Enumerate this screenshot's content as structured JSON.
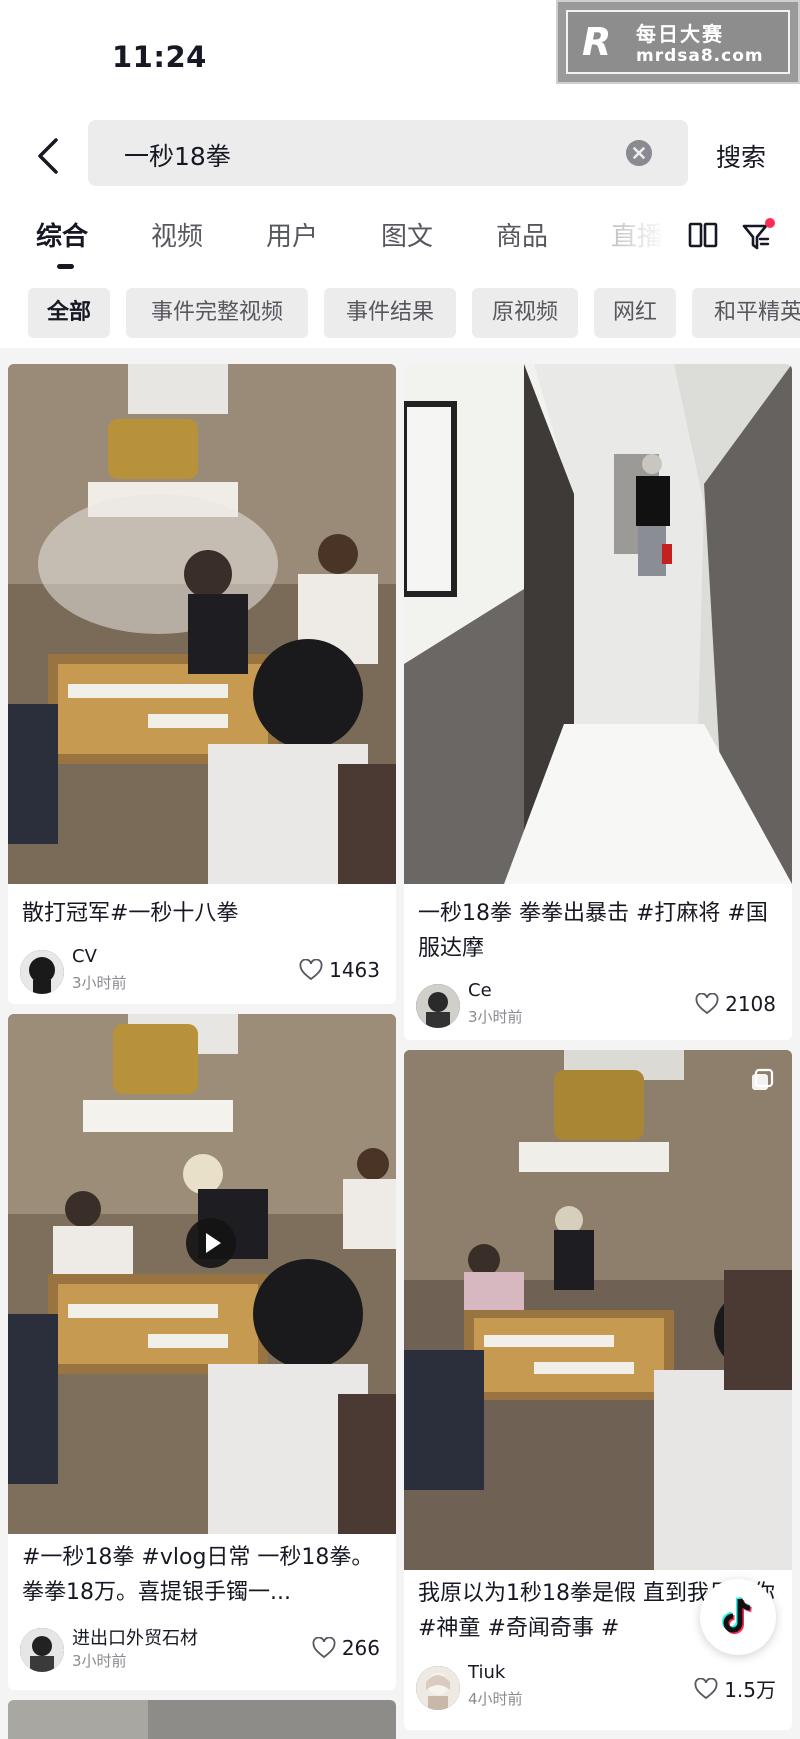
{
  "status_bar": {
    "time": "11:24"
  },
  "watermark": {
    "logo": "R",
    "line1": "每日大赛",
    "line2": "mrdsa8.com"
  },
  "search": {
    "query": "一秒18拳",
    "search_button": "搜索"
  },
  "tabs": [
    "综合",
    "视频",
    "用户",
    "图文",
    "商品",
    "直播"
  ],
  "active_tab": "综合",
  "chips": [
    "全部",
    "事件完整视频",
    "事件结果",
    "原视频",
    "网红",
    "和平精英"
  ],
  "active_chip": "全部",
  "cards": [
    {
      "title": "散打冠军#一秒十八拳",
      "user": "CV",
      "time": "3小时前",
      "likes": "1463"
    },
    {
      "title": "一秒18拳 拳拳出暴击 #打麻将 #国服达摩",
      "user": "Ce",
      "time": "3小时前",
      "likes": "2108"
    },
    {
      "title": "#一秒18拳 #vlog日常 一秒18拳。拳拳18万。喜提银手镯一...",
      "user": "进出口外贸石材",
      "time": "3小时前",
      "likes": "266"
    },
    {
      "title": "我原以为1秒18拳是假 直到我见了你#神童 #奇闻奇事 #",
      "user": "Tiuk",
      "time": "4小时前",
      "likes": "1.5万"
    }
  ],
  "colors": {
    "accent_dot": "#fe2c55",
    "text_primary": "#161823",
    "text_secondary": "#8a8b91"
  },
  "icons": [
    "back-arrow-icon",
    "clear-icon",
    "grid-view-icon",
    "filter-icon",
    "heart-icon",
    "play-icon",
    "multi-image-icon",
    "tiktok-logo-icon"
  ]
}
